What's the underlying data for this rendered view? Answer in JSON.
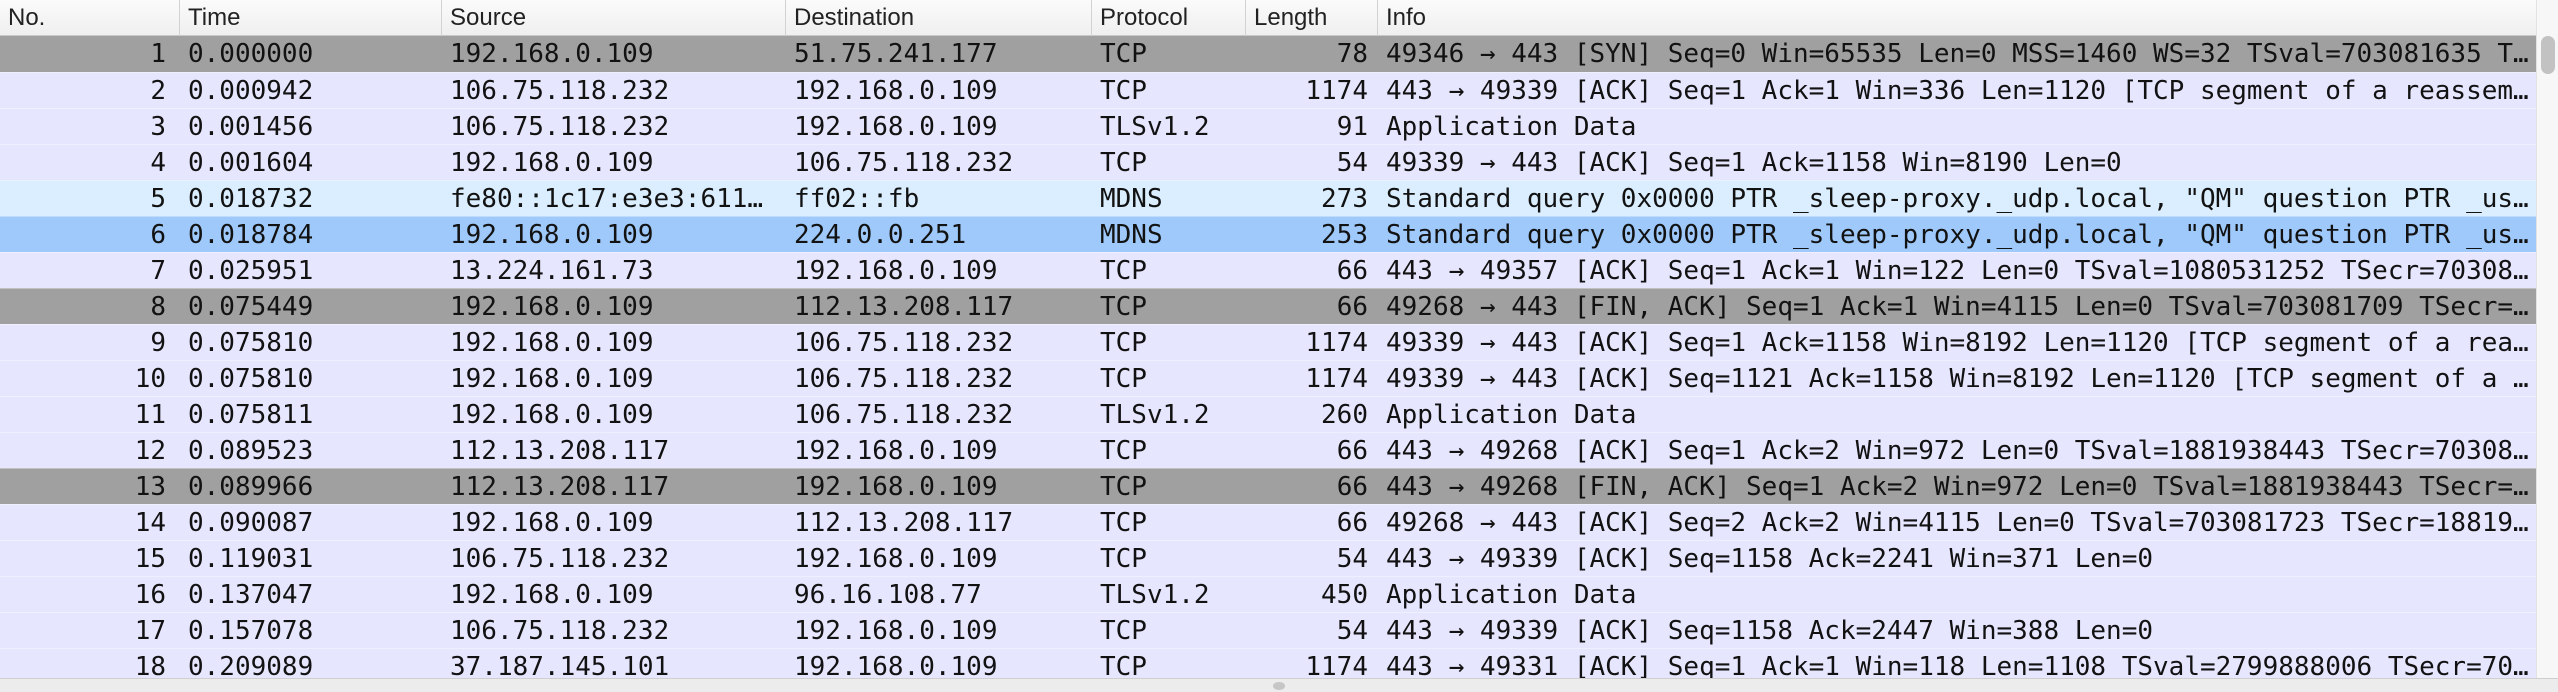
{
  "columns": {
    "no": "No.",
    "time": "Time",
    "source": "Source",
    "destination": "Destination",
    "protocol": "Protocol",
    "length": "Length",
    "info": "Info"
  },
  "packets": [
    {
      "no": "1",
      "time": "0.000000",
      "source": "192.168.0.109",
      "destination": "51.75.241.177",
      "protocol": "TCP",
      "length": "78",
      "info": "49346 → 443 [SYN] Seq=0 Win=65535 Len=0 MSS=1460 WS=32 TSval=703081635 T…"
    },
    {
      "no": "2",
      "time": "0.000942",
      "source": "106.75.118.232",
      "destination": "192.168.0.109",
      "protocol": "TCP",
      "length": "1174",
      "info": "443 → 49339 [ACK] Seq=1 Ack=1 Win=336 Len=1120 [TCP segment of a reassem…"
    },
    {
      "no": "3",
      "time": "0.001456",
      "source": "106.75.118.232",
      "destination": "192.168.0.109",
      "protocol": "TLSv1.2",
      "length": "91",
      "info": "Application Data"
    },
    {
      "no": "4",
      "time": "0.001604",
      "source": "192.168.0.109",
      "destination": "106.75.118.232",
      "protocol": "TCP",
      "length": "54",
      "info": "49339 → 443 [ACK] Seq=1 Ack=1158 Win=8190 Len=0"
    },
    {
      "no": "5",
      "time": "0.018732",
      "source": "fe80::1c17:e3e3:611…",
      "destination": "ff02::fb",
      "protocol": "MDNS",
      "length": "273",
      "info": "Standard query 0x0000 PTR _sleep-proxy._udp.local, \"QM\" question PTR _us…"
    },
    {
      "no": "6",
      "time": "0.018784",
      "source": "192.168.0.109",
      "destination": "224.0.0.251",
      "protocol": "MDNS",
      "length": "253",
      "info": "Standard query 0x0000 PTR _sleep-proxy._udp.local, \"QM\" question PTR _us…"
    },
    {
      "no": "7",
      "time": "0.025951",
      "source": "13.224.161.73",
      "destination": "192.168.0.109",
      "protocol": "TCP",
      "length": "66",
      "info": "443 → 49357 [ACK] Seq=1 Ack=1 Win=122 Len=0 TSval=1080531252 TSecr=70308…"
    },
    {
      "no": "8",
      "time": "0.075449",
      "source": "192.168.0.109",
      "destination": "112.13.208.117",
      "protocol": "TCP",
      "length": "66",
      "info": "49268 → 443 [FIN, ACK] Seq=1 Ack=1 Win=4115 Len=0 TSval=703081709 TSecr=…"
    },
    {
      "no": "9",
      "time": "0.075810",
      "source": "192.168.0.109",
      "destination": "106.75.118.232",
      "protocol": "TCP",
      "length": "1174",
      "info": "49339 → 443 [ACK] Seq=1 Ack=1158 Win=8192 Len=1120 [TCP segment of a rea…"
    },
    {
      "no": "10",
      "time": "0.075810",
      "source": "192.168.0.109",
      "destination": "106.75.118.232",
      "protocol": "TCP",
      "length": "1174",
      "info": "49339 → 443 [ACK] Seq=1121 Ack=1158 Win=8192 Len=1120 [TCP segment of a …"
    },
    {
      "no": "11",
      "time": "0.075811",
      "source": "192.168.0.109",
      "destination": "106.75.118.232",
      "protocol": "TLSv1.2",
      "length": "260",
      "info": "Application Data"
    },
    {
      "no": "12",
      "time": "0.089523",
      "source": "112.13.208.117",
      "destination": "192.168.0.109",
      "protocol": "TCP",
      "length": "66",
      "info": "443 → 49268 [ACK] Seq=1 Ack=2 Win=972 Len=0 TSval=1881938443 TSecr=70308…"
    },
    {
      "no": "13",
      "time": "0.089966",
      "source": "112.13.208.117",
      "destination": "192.168.0.109",
      "protocol": "TCP",
      "length": "66",
      "info": "443 → 49268 [FIN, ACK] Seq=1 Ack=2 Win=972 Len=0 TSval=1881938443 TSecr=…"
    },
    {
      "no": "14",
      "time": "0.090087",
      "source": "192.168.0.109",
      "destination": "112.13.208.117",
      "protocol": "TCP",
      "length": "66",
      "info": "49268 → 443 [ACK] Seq=2 Ack=2 Win=4115 Len=0 TSval=703081723 TSecr=18819…"
    },
    {
      "no": "15",
      "time": "0.119031",
      "source": "106.75.118.232",
      "destination": "192.168.0.109",
      "protocol": "TCP",
      "length": "54",
      "info": "443 → 49339 [ACK] Seq=1158 Ack=2241 Win=371 Len=0"
    },
    {
      "no": "16",
      "time": "0.137047",
      "source": "192.168.0.109",
      "destination": "96.16.108.77",
      "protocol": "TLSv1.2",
      "length": "450",
      "info": "Application Data"
    },
    {
      "no": "17",
      "time": "0.157078",
      "source": "106.75.118.232",
      "destination": "192.168.0.109",
      "protocol": "TCP",
      "length": "54",
      "info": "443 → 49339 [ACK] Seq=1158 Ack=2447 Win=388 Len=0"
    },
    {
      "no": "18",
      "time": "0.209089",
      "source": "37.187.145.101",
      "destination": "192.168.0.109",
      "protocol": "TCP",
      "length": "1174",
      "info": "443 → 49331 [ACK] Seq=1 Ack=1 Win=118 Len=1108 TSval=2799888006 TSecr=70…"
    }
  ],
  "selected_row": "6",
  "colors": {
    "tcp_row": "#e7e6ff",
    "mdns_row": "#daeeff",
    "syn_fin_row": "#a0a0a0",
    "selected_row": "#9fc9fa"
  },
  "icons": {
    "splitter": "split-handle-icon"
  }
}
